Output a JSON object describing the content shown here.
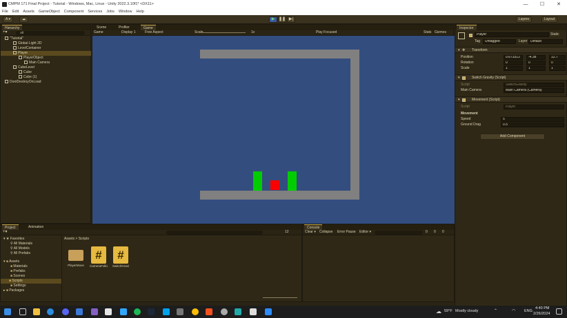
{
  "window": {
    "title": "CMPM 171 Final Project - Tutorial - Windows, Mac, Linux - Unity 2022.3.10f1* <DX11>",
    "controls": [
      "—",
      "☐",
      "✕"
    ]
  },
  "menu": [
    "File",
    "Edit",
    "Assets",
    "GameObject",
    "Component",
    "Services",
    "Jobs",
    "Window",
    "Help"
  ],
  "toolbar": {
    "account": "A ▾",
    "cloud": "☁",
    "layers": "Layers",
    "layout": "Layout",
    "play": "▶",
    "pause": "❚❚",
    "step": "▶|"
  },
  "hierarchy": {
    "tab": "Hierarchy",
    "search_placeholder": "All",
    "items": [
      {
        "label": "\"Tutorial\"",
        "indent": 1
      },
      {
        "label": "Global Light 2D",
        "indent": 2
      },
      {
        "label": "LevelContainer",
        "indent": 2
      },
      {
        "label": "Player",
        "indent": 2
      },
      {
        "label": "PlayerObject",
        "indent": 3
      },
      {
        "label": "Main Camera",
        "indent": 4
      },
      {
        "label": "CubeLevel",
        "indent": 2
      },
      {
        "label": "Cube",
        "indent": 2
      },
      {
        "label": "Cube (1)",
        "indent": 2
      },
      {
        "label": "DontDestroyOnLoad",
        "indent": 1
      }
    ]
  },
  "game_view": {
    "tabs": [
      "Scene",
      "Profiler",
      "Game"
    ],
    "mode": "Game",
    "display": "Display 1",
    "aspect": "Free Aspect",
    "scale_label": "Scale",
    "scale_value": "1x",
    "play_focused": "Play Focused",
    "stats": "Stats",
    "gizmos": "Gizmos"
  },
  "inspector": {
    "tab": "Inspector",
    "object_name": "Player",
    "static_label": "Static",
    "tag_label": "Tag",
    "tag_value": "Untagged",
    "layer_label": "Layer",
    "layer_value": "Default",
    "transform": {
      "title": "Transform",
      "position_label": "Position",
      "position": {
        "x": "0.673312",
        "y": "-4.38",
        "z": "12.7"
      },
      "rotation_label": "Rotation",
      "rotation": {
        "x": "0",
        "y": "0",
        "z": "0"
      },
      "scale_label": "Scale",
      "scale": {
        "x": "1",
        "y": "1",
        "z": "1"
      }
    },
    "switch_gravity": {
      "title": "Switch Gravity (Script)",
      "script_label": "Script",
      "script_value": "SwitchGravity",
      "camera_label": "Main Camera",
      "camera_value": "Main Camera (Camera)"
    },
    "movement": {
      "title": "Movement (Script)",
      "script_label": "Script",
      "script_value": "Player",
      "section": "Movement",
      "speed_label": "Speed",
      "speed_value": "5",
      "drag_label": "Ground Drag",
      "drag_value": "0.5"
    },
    "add_component": "Add Component"
  },
  "project": {
    "tabs": [
      "Project",
      "Animation"
    ],
    "breadcrumb": "Assets > Scripts",
    "tree": [
      {
        "label": "Favorites",
        "indent": 0
      },
      {
        "label": "All Materials",
        "indent": 1
      },
      {
        "label": "All Models",
        "indent": 1
      },
      {
        "label": "All Prefabs",
        "indent": 1
      },
      {
        "label": "Assets",
        "indent": 0
      },
      {
        "label": "Materials",
        "indent": 1
      },
      {
        "label": "Prefabs",
        "indent": 1
      },
      {
        "label": "Scenes",
        "indent": 1
      },
      {
        "label": "Scripts",
        "indent": 1
      },
      {
        "label": "Settings",
        "indent": 1
      },
      {
        "label": "Packages",
        "indent": 0
      }
    ],
    "assets": [
      {
        "label": "PlayerMove",
        "kind": "folder"
      },
      {
        "label": "CameraFollo",
        "kind": "script"
      },
      {
        "label": "SwitchGravi",
        "kind": "script"
      }
    ],
    "hidden_count": "12"
  },
  "console": {
    "tab": "Console",
    "buttons": [
      "Clear ▾",
      "Collapse",
      "Error Pause",
      "Editor ▾"
    ],
    "counts": [
      "0",
      "0",
      "0"
    ]
  },
  "taskbar": {
    "weather_temp": "59°F",
    "weather_text": "Mostly cloudy",
    "language": "ENG",
    "time": "4:40 PM",
    "date": "2/26/2024"
  },
  "colors": {
    "game_bg": "#334d7f",
    "wall": "#808080",
    "player": "#ff0000",
    "pillar": "#00cc00",
    "accent": "#c9a94a"
  }
}
